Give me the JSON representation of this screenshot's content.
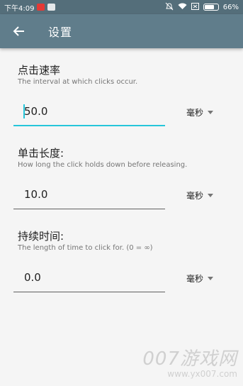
{
  "status_bar": {
    "time": "下午4:09",
    "battery": "66%"
  },
  "app_bar": {
    "title": "设置"
  },
  "settings": [
    {
      "title": "点击速率",
      "description": "The interval at which clicks occur.",
      "value": "50.0",
      "unit": "毫秒"
    },
    {
      "title": "单击长度:",
      "description": "How long the click holds down before releasing.",
      "value": "10.0",
      "unit": "毫秒"
    },
    {
      "title": "持续时间:",
      "description": "The length of time to click for. (0 = ∞)",
      "value": "0.0",
      "unit": "毫秒"
    }
  ],
  "watermark": {
    "main": "007游戏网",
    "sub": "www.yx007.com"
  },
  "colors": {
    "status_bar": "#546e7a",
    "app_bar": "#607d8b",
    "accent": "#26c6da"
  }
}
